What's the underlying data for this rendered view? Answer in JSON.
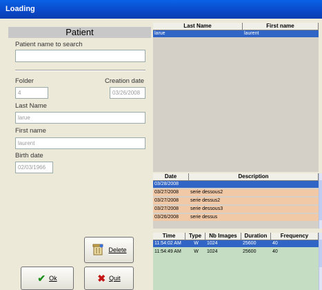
{
  "window": {
    "title": "Loading"
  },
  "patient": {
    "header": "Patient",
    "search_label": "Patient name to search",
    "search_value": "",
    "folder_label": "Folder",
    "folder_value": "4",
    "creation_label": "Creation date",
    "creation_value": "03/26/2008",
    "lastname_label": "Last Name",
    "lastname_value": "larue",
    "firstname_label": "First name",
    "firstname_value": "laurent",
    "birth_label": "Birth date",
    "birth_value": "02/03/1966"
  },
  "buttons": {
    "delete": "Delete",
    "ok": "Ok",
    "quit": "Quit"
  },
  "patients_table": {
    "columns": [
      "Last Name",
      "First name"
    ],
    "rows": [
      [
        "larue",
        "laurent"
      ]
    ]
  },
  "exams_table": {
    "columns": [
      "Date",
      "Description"
    ],
    "rows": [
      [
        "03/28/2008",
        ""
      ],
      [
        "03/27/2008",
        "serie dessous2"
      ],
      [
        "03/27/2008",
        "serie dessus2"
      ],
      [
        "03/27/2008",
        "serie dessous3"
      ],
      [
        "03/26/2008",
        "serie dessus"
      ]
    ]
  },
  "series_table": {
    "columns": [
      "Time",
      "Type",
      "Nb Images",
      "Duration",
      "Frequency"
    ],
    "rows": [
      [
        "11:54:02 AM",
        "W",
        "1024",
        "25600",
        "40"
      ],
      [
        "11:54:49 AM",
        "W",
        "1024",
        "25600",
        "40"
      ]
    ]
  },
  "colors": {
    "selection": "#3165c5",
    "exam_row": "#f2c9a7",
    "series_row": "#c4ddc3",
    "title": "#0a55d8"
  }
}
